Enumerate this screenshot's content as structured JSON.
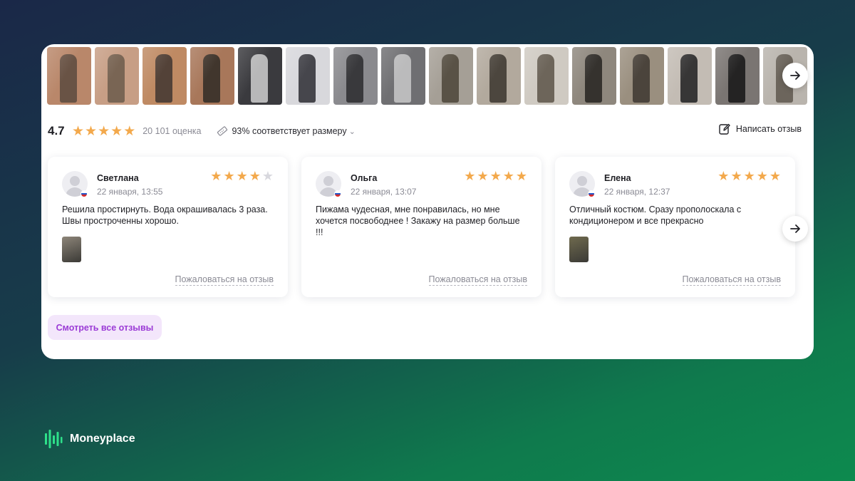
{
  "photos": [
    {
      "bg": "#b9876a",
      "fig": "#5a4a3e"
    },
    {
      "bg": "#c79e85",
      "fig": "#6b5a4b"
    },
    {
      "bg": "#bf8a63",
      "fig": "#3f3530"
    },
    {
      "bg": "#a8775a",
      "fig": "#2f2a26"
    },
    {
      "bg": "#3a3a3e",
      "fig": "#cfcfcf"
    },
    {
      "bg": "#d8d8dc",
      "fig": "#2d2d33"
    },
    {
      "bg": "#8a8a8e",
      "fig": "#2a2a2e"
    },
    {
      "bg": "#6f6f72",
      "fig": "#c9c9c9"
    },
    {
      "bg": "#a59f96",
      "fig": "#4b4438"
    },
    {
      "bg": "#b2a99d",
      "fig": "#3a352e"
    },
    {
      "bg": "#cfcac2",
      "fig": "#5c5448"
    },
    {
      "bg": "#8e877d",
      "fig": "#262320"
    },
    {
      "bg": "#9a8f7f",
      "fig": "#3d3730"
    },
    {
      "bg": "#c3bcb4",
      "fig": "#1e1e20"
    },
    {
      "bg": "#7a7572",
      "fig": "#151515"
    },
    {
      "bg": "#b9b4ad",
      "fig": "#5e574d"
    }
  ],
  "summary": {
    "rating": "4.7",
    "rating_count": "20 101 оценка",
    "fit_text": "93% соответствует размеру",
    "write_review": "Написать отзыв",
    "stars": [
      1,
      1,
      1,
      1,
      1
    ]
  },
  "reviews": [
    {
      "name": "Светлана",
      "date": "22 января, 13:55",
      "rating": 4,
      "text": "Решила простирнуть. Вода окрашивалась 3 раза. Швы простроченны хорошо.",
      "has_photo": true,
      "photo_bg": "#8d8579",
      "report": "Пожаловаться на отзыв"
    },
    {
      "name": "Ольга",
      "date": "22 января, 13:07",
      "rating": 5,
      "text": "Пижама чудесная, мне понравилась, но мне хочется посвободнее ! Закажу на размер больше !!!",
      "has_photo": false,
      "photo_bg": "",
      "report": "Пожаловаться на отзыв"
    },
    {
      "name": "Елена",
      "date": "22 января, 12:37",
      "rating": 5,
      "text": "Отличный костюм. Сразу прополоскала с кондиционером и все прекрасно",
      "has_photo": true,
      "photo_bg": "#6f6a4e",
      "report": "Пожаловаться на отзыв"
    }
  ],
  "all_reviews_button": "Смотреть все отзывы",
  "brand": {
    "name": "Moneyplace"
  },
  "colors": {
    "star": "#f3a94c",
    "star_empty": "#d8d8de",
    "accent": "#9b3bd6",
    "brand_green": "#2ee08a"
  }
}
